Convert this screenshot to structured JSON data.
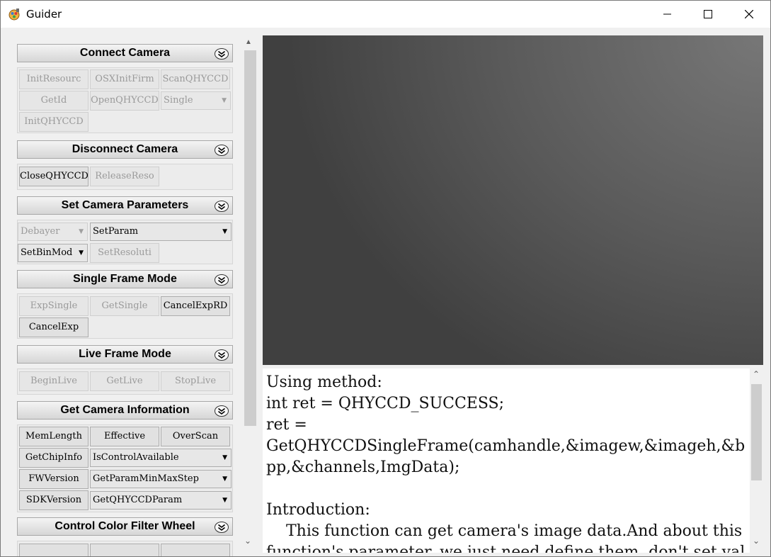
{
  "window": {
    "title": "Guider"
  },
  "groups": [
    {
      "header": "Connect Camera",
      "items": [
        {
          "label": "InitResourc",
          "enabled": false
        },
        {
          "label": "OSXInitFirm",
          "enabled": false
        },
        {
          "label": "ScanQHYCCD",
          "enabled": false
        },
        {
          "label": "GetId",
          "enabled": false
        },
        {
          "label": "OpenQHYCCD",
          "enabled": false
        },
        {
          "label": "Single",
          "enabled": false,
          "type": "combo"
        },
        {
          "label": "InitQHYCCD",
          "enabled": false
        }
      ]
    },
    {
      "header": "Disconnect Camera",
      "items": [
        {
          "label": "CloseQHYCCD",
          "enabled": true
        },
        {
          "label": "ReleaseReso",
          "enabled": false
        }
      ]
    },
    {
      "header": "Set Camera Parameters",
      "items": [
        {
          "label": "Debayer",
          "enabled": false,
          "type": "combo"
        },
        {
          "label": "SetParam",
          "enabled": true,
          "type": "combo"
        },
        {
          "label": "SetBinMod",
          "enabled": true,
          "type": "combo"
        },
        {
          "label": "SetResoluti",
          "enabled": false
        }
      ]
    },
    {
      "header": "Single Frame Mode",
      "items": [
        {
          "label": "ExpSingle",
          "enabled": false
        },
        {
          "label": "GetSingle",
          "enabled": false
        },
        {
          "label": "CancelExpRD",
          "enabled": true
        },
        {
          "label": "CancelExp",
          "enabled": true
        }
      ]
    },
    {
      "header": "Live Frame Mode",
      "items": [
        {
          "label": "BeginLive",
          "enabled": false
        },
        {
          "label": "GetLive",
          "enabled": false
        },
        {
          "label": "StopLive",
          "enabled": false
        }
      ]
    },
    {
      "header": "Get Camera Information",
      "items": [
        {
          "label": "MemLength",
          "enabled": true
        },
        {
          "label": "Effective",
          "enabled": true
        },
        {
          "label": "OverScan",
          "enabled": true
        },
        {
          "label": "GetChipInfo",
          "enabled": true
        },
        {
          "label": "IsControlAvailable",
          "enabled": true,
          "type": "combo"
        },
        {
          "label": "FWVersion",
          "enabled": true
        },
        {
          "label": "GetParamMinMaxStep",
          "enabled": true,
          "type": "combo"
        },
        {
          "label": "SDKVersion",
          "enabled": true
        },
        {
          "label": "GetQHYCCDParam",
          "enabled": true,
          "type": "combo"
        }
      ]
    },
    {
      "header": "Control Color Filter Wheel",
      "items": []
    }
  ],
  "text_panel": {
    "lines": [
      "Using method:",
      "int ret = QHYCCD_SUCCESS;",
      "ret =",
      "GetQHYCCDSingleFrame(camhandle,&imagew,&imageh,&bpp,&channels,ImgData);",
      "",
      "Introduction:",
      "    This function can get camera's image data.And about this function's parameter, we just need define them, don't set values."
    ]
  }
}
